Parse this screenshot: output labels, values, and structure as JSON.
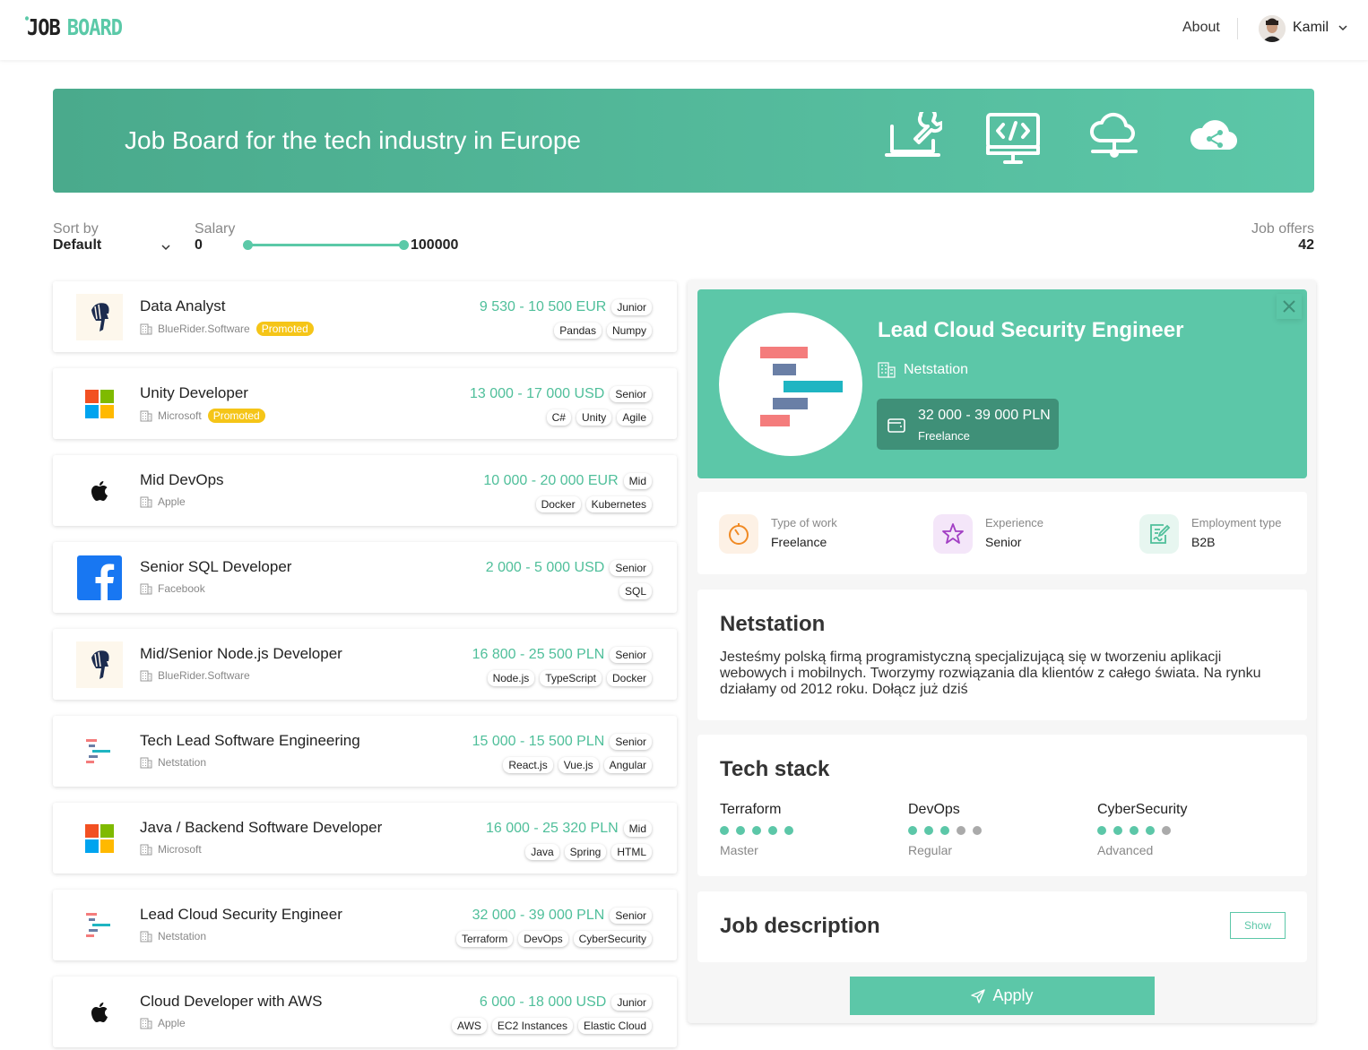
{
  "brand": {
    "logo_part1": "JOB",
    "logo_part2": "BOARD"
  },
  "nav": {
    "about": "About",
    "user_name": "Kamil"
  },
  "banner": {
    "title": "Job Board for the tech industry in Europe",
    "icons": [
      "laptop-wrench-icon",
      "monitor-code-icon",
      "cloud-network-icon",
      "cloud-share-icon"
    ]
  },
  "filters": {
    "sort_label": "Sort by",
    "sort_value": "Default",
    "salary_label": "Salary",
    "salary_min": "0",
    "salary_max": "100000",
    "offers_label": "Job offers",
    "offers_count": "42"
  },
  "colors": {
    "accent": "#5cc7a8",
    "accent_dark": "#3f9078",
    "promoted": "#f5c518"
  },
  "jobs": [
    {
      "title": "Data Analyst",
      "company": "BlueRider.Software",
      "promoted": "Promoted",
      "salary": "9 530 - 10 500 EUR",
      "level": "Junior",
      "tags": [
        "Pandas",
        "Numpy"
      ],
      "logo": "bluerider"
    },
    {
      "title": "Unity Developer",
      "company": "Microsoft",
      "promoted": "Promoted",
      "salary": "13 000 - 17 000 USD",
      "level": "Senior",
      "tags": [
        "C#",
        "Unity",
        "Agile"
      ],
      "logo": "microsoft"
    },
    {
      "title": "Mid DevOps",
      "company": "Apple",
      "promoted": "",
      "salary": "10 000 - 20 000 EUR",
      "level": "Mid",
      "tags": [
        "Docker",
        "Kubernetes"
      ],
      "logo": "apple"
    },
    {
      "title": "Senior SQL Developer",
      "company": "Facebook",
      "promoted": "",
      "salary": "2 000 - 5 000 USD",
      "level": "Senior",
      "tags": [
        "SQL"
      ],
      "logo": "facebook"
    },
    {
      "title": "Mid/Senior Node.js Developer",
      "company": "BlueRider.Software",
      "promoted": "",
      "salary": "16 800 - 25 500 PLN",
      "level": "Senior",
      "tags": [
        "Node.js",
        "TypeScript",
        "Docker"
      ],
      "logo": "bluerider"
    },
    {
      "title": "Tech Lead Software Engineering",
      "company": "Netstation",
      "promoted": "",
      "salary": "15 000 - 15 500 PLN",
      "level": "Senior",
      "tags": [
        "React.js",
        "Vue.js",
        "Angular"
      ],
      "logo": "netstation"
    },
    {
      "title": "Java / Backend Software Developer",
      "company": "Microsoft",
      "promoted": "",
      "salary": "16 000 - 25 320 PLN",
      "level": "Mid",
      "tags": [
        "Java",
        "Spring",
        "HTML"
      ],
      "logo": "microsoft"
    },
    {
      "title": "Lead Cloud Security Engineer",
      "company": "Netstation",
      "promoted": "",
      "salary": "32 000 - 39 000 PLN",
      "level": "Senior",
      "tags": [
        "Terraform",
        "DevOps",
        "CyberSecurity"
      ],
      "logo": "netstation"
    },
    {
      "title": "Cloud Developer with AWS",
      "company": "Apple",
      "promoted": "",
      "salary": "6 000 - 18 000 USD",
      "level": "Junior",
      "tags": [
        "AWS",
        "EC2 Instances",
        "Elastic Cloud"
      ],
      "logo": "apple"
    }
  ],
  "detail": {
    "title": "Lead Cloud Security Engineer",
    "company": "Netstation",
    "salary": "32 000 - 39 000 PLN",
    "salary_type": "Freelance",
    "info": [
      {
        "label": "Type of work",
        "value": "Freelance",
        "icon": "timer-icon",
        "color": "#f08a24",
        "bg": "#fdf1e5"
      },
      {
        "label": "Experience",
        "value": "Senior",
        "icon": "star-icon",
        "color": "#a23fc4",
        "bg": "#f4e6f9"
      },
      {
        "label": "Employment type",
        "value": "B2B",
        "icon": "signed-document-icon",
        "color": "#4fbf9a",
        "bg": "#e7f6f0"
      }
    ],
    "company_section_title": "Netstation",
    "company_description": "Jesteśmy polską firmą programistyczną specjalizującą się w tworzeniu aplikacji webowych i mobilnych. Tworzymy rozwiązania dla klientów z całego świata. Na rynku działamy od 2012 roku. Dołącz już dziś",
    "tech_stack_title": "Tech stack",
    "tech_stack": [
      {
        "name": "Terraform",
        "level": "Master",
        "rating": 5
      },
      {
        "name": "DevOps",
        "level": "Regular",
        "rating": 3
      },
      {
        "name": "CyberSecurity",
        "level": "Advanced",
        "rating": 4
      }
    ],
    "job_description_title": "Job description",
    "show_label": "Show",
    "apply_label": "Apply"
  }
}
